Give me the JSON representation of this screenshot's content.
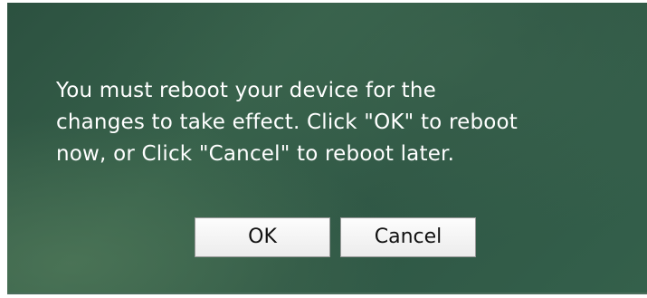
{
  "dialog": {
    "message_lines": [
      "You must reboot your device for the",
      "changes to take effect. Click \"OK\" to reboot",
      "now, or Click \"Cancel\" to reboot later."
    ],
    "ok_label": "OK",
    "cancel_label": "Cancel"
  },
  "colors": {
    "background": "#2f5745",
    "text": "#ffffff",
    "button_face": "#f5f5f5"
  }
}
